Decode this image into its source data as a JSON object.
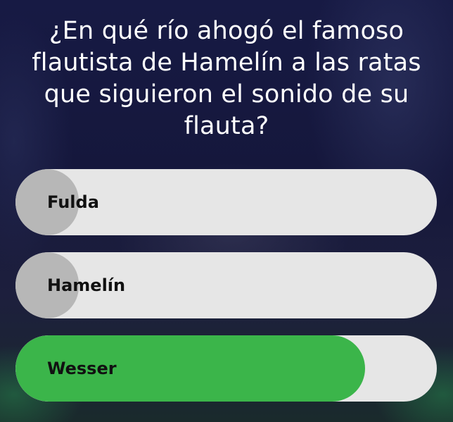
{
  "quiz": {
    "question": "¿En qué río ahogó el famoso flautista de Hamelín a las ratas que siguieron el sonido de su flauta?",
    "answers": [
      {
        "label": "Fulda",
        "result_fraction": 0.15
      },
      {
        "label": "Hamelín",
        "result_fraction": 0.15
      },
      {
        "label": "Wesser",
        "result_fraction": 0.83
      }
    ]
  },
  "colors": {
    "bar_background": "#e6e6e6",
    "incorrect_fill": "#b7b7b7",
    "correct_fill": "#3bb54a",
    "question_text": "#ffffff"
  }
}
